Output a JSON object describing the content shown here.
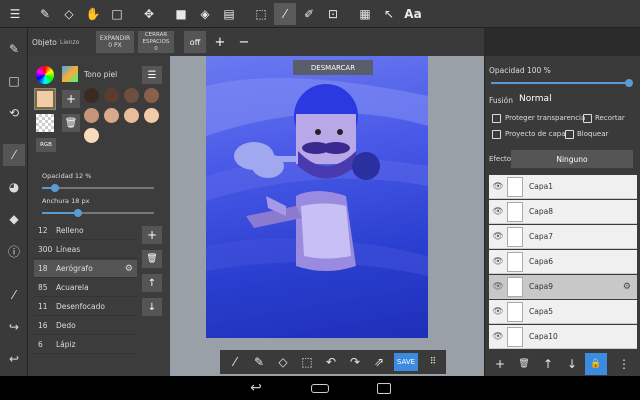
{
  "toolbar": {
    "icons": [
      "menu-icon",
      "pen-icon",
      "eraser-icon",
      "hand-icon",
      "rect-select-icon",
      "move-icon",
      "fill-square-icon",
      "bucket-icon",
      "gradient-icon",
      "select-rect-icon",
      "magic-wand-icon",
      "edit-selection-icon",
      "transform-selection-icon",
      "layers-stamp-icon",
      "cursor-icon"
    ],
    "text_label": "Aa"
  },
  "subbar": {
    "object_label": "Objeto",
    "object_value": "Lienzo",
    "expand_label": "EXPANDIR",
    "expand_sub": "0 PX",
    "close_label": "CERRAR ESPACIOS",
    "close_sub": "0",
    "off_label": "off",
    "plus": "+",
    "minus": "−"
  },
  "left_panel": {
    "skin_label": "Tono piel",
    "rgb_label": "RGB",
    "opacity_label": "Opacidad 12 %",
    "opacity_value": 0.12,
    "width_label": "Anchura 18 px",
    "width_value": 0.32,
    "swatches": [
      "#3a2a22",
      "#5a3c30",
      "#6e4e3e",
      "#8a604a",
      "#c8957a",
      "#d8a98a",
      "#e8bd9a",
      "#f2cca8",
      "#f8dcbc"
    ],
    "brushes": [
      {
        "size": "12",
        "name": "Relleno"
      },
      {
        "size": "300",
        "name": "Líneas"
      },
      {
        "size": "18",
        "name": "Aerógrafo"
      },
      {
        "size": "85",
        "name": "Acuarela"
      },
      {
        "size": "11",
        "name": "Desenfocado"
      },
      {
        "size": "16",
        "name": "Dedo"
      },
      {
        "size": "6",
        "name": "Lápiz"
      }
    ]
  },
  "canvas": {
    "deselect_label": "DESMARCAR",
    "save_label": "SAVE"
  },
  "right_panel": {
    "opacity_label": "Opacidad 100 %",
    "opacity_value": 1.0,
    "blend_label": "Fusión",
    "blend_value": "Normal",
    "protect_label": "Proteger transparencia",
    "crop_label": "Recortar",
    "project_label": "Proyecto de capa",
    "lock_label": "Bloquear",
    "effect_label": "Efecto",
    "effect_value": "Ninguno",
    "layers": [
      "Capa1",
      "Capa8",
      "Capa7",
      "Capa6",
      "Capa9",
      "Capa5",
      "Capa10"
    ]
  },
  "colors": {
    "accent": "#5b9bd5",
    "canvas_dark": "#2a3fd0",
    "canvas_light": "#6b7af0"
  }
}
